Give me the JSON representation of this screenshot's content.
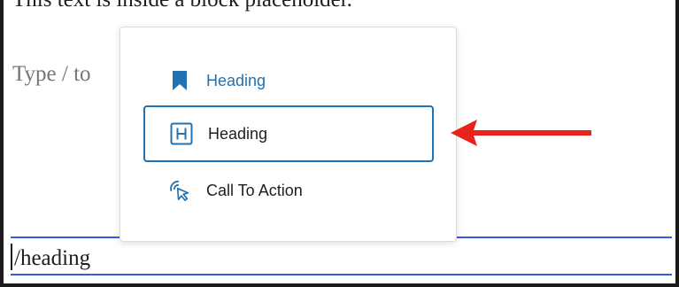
{
  "editor": {
    "block_text": "This text is inside a block placeholder.",
    "placeholder": "Type / to",
    "slash_command": "/heading"
  },
  "inserter": {
    "items": [
      {
        "label": "Heading",
        "icon": "bookmark-icon",
        "state": "variation"
      },
      {
        "label": "Heading",
        "icon": "heading-icon",
        "state": "selected"
      },
      {
        "label": "Call To Action",
        "icon": "call-to-action-icon",
        "state": "default"
      }
    ]
  },
  "colors": {
    "accent": "#2271b1",
    "input_border": "#3858e9",
    "annotation_arrow": "#e8231a"
  }
}
